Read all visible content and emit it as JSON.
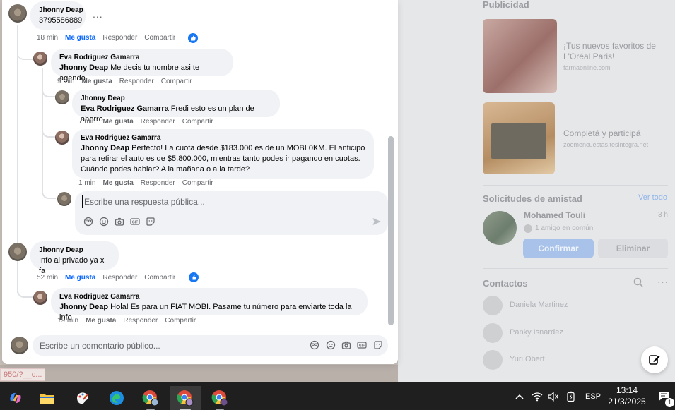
{
  "sidebar": {
    "ads_title": "Publicidad",
    "ads": [
      {
        "name": "¡Tus nuevos favoritos de L'Oréal Paris!",
        "url": "farmaonline.com"
      },
      {
        "name": "Completá y participá",
        "url": "zoomencuestas.tesintegra.net"
      }
    ],
    "friend_requests_title": "Solicitudes de amistad",
    "see_all": "Ver todo",
    "request": {
      "name": "Mohamed Touli",
      "time": "3 h",
      "mutual": "1 amigo en común",
      "confirm": "Confirmar",
      "delete": "Eliminar"
    },
    "contacts_title": "Contactos",
    "contacts": [
      "Daniela Martinez",
      "Panky Isnardez",
      "Yuri Obert"
    ]
  },
  "url_tooltip": "950/?__c...",
  "comments": [
    {
      "author": "Jhonny Deap",
      "text": "3795586889",
      "time": "18 min",
      "like": "Me gusta",
      "reply": "Responder",
      "share": "Compartir",
      "liked": true,
      "more": "..."
    },
    {
      "author": "Eva Rodriguez Gamarra",
      "mention": "Jhonny Deap",
      "text": " Me decis tu nombre asi te agendo",
      "time": "9 min",
      "like": "Me gusta",
      "reply": "Responder",
      "share": "Compartir"
    },
    {
      "author": "Jhonny Deap",
      "mention": "Eva Rodriguez Gamarra",
      "text": " Fredi esto es un plan de ahorro",
      "time": "7 min",
      "like": "Me gusta",
      "reply": "Responder",
      "share": "Compartir"
    },
    {
      "author": "Eva Rodriguez Gamarra",
      "mention": "Jhonny Deap",
      "text_line1": " Perfecto! La cuota desde $183.000 es de un MOBI 0KM. El anticipo",
      "text_line2": "para retirar el auto es de $5.800.000, mientras tanto podes ir pagando en cuotas.",
      "text_line3": "Cuándo podes hablar? A la mañana o a la tarde?",
      "time": "1 min",
      "like": "Me gusta",
      "reply": "Responder",
      "share": "Compartir"
    },
    {
      "author": "Jhonny Deap",
      "text": "Info al privado ya x fa",
      "time": "52 min",
      "like": "Me gusta",
      "reply": "Responder",
      "share": "Compartir",
      "liked": true
    },
    {
      "author": "Eva Rodriguez Gamarra",
      "mention": "Jhonny Deap",
      "text": " Hola! Es para un FIAT MOBI. Pasame tu número para enviarte toda la info",
      "time": "19 min",
      "like": "Me gusta",
      "reply": "Responder",
      "share": "Compartir"
    }
  ],
  "reply_box": {
    "placeholder": "Escribe una respuesta pública..."
  },
  "composer": {
    "placeholder": "Escribe un comentario público..."
  },
  "taskbar": {
    "language": "ESP",
    "time": "13:14",
    "date": "21/3/2025",
    "notification_count": "1"
  },
  "colors": {
    "link_blue": "#0866ff",
    "like_blue": "#1877f2",
    "bubble": "#f0f2f5",
    "taskbar": "#1f1f1f"
  }
}
